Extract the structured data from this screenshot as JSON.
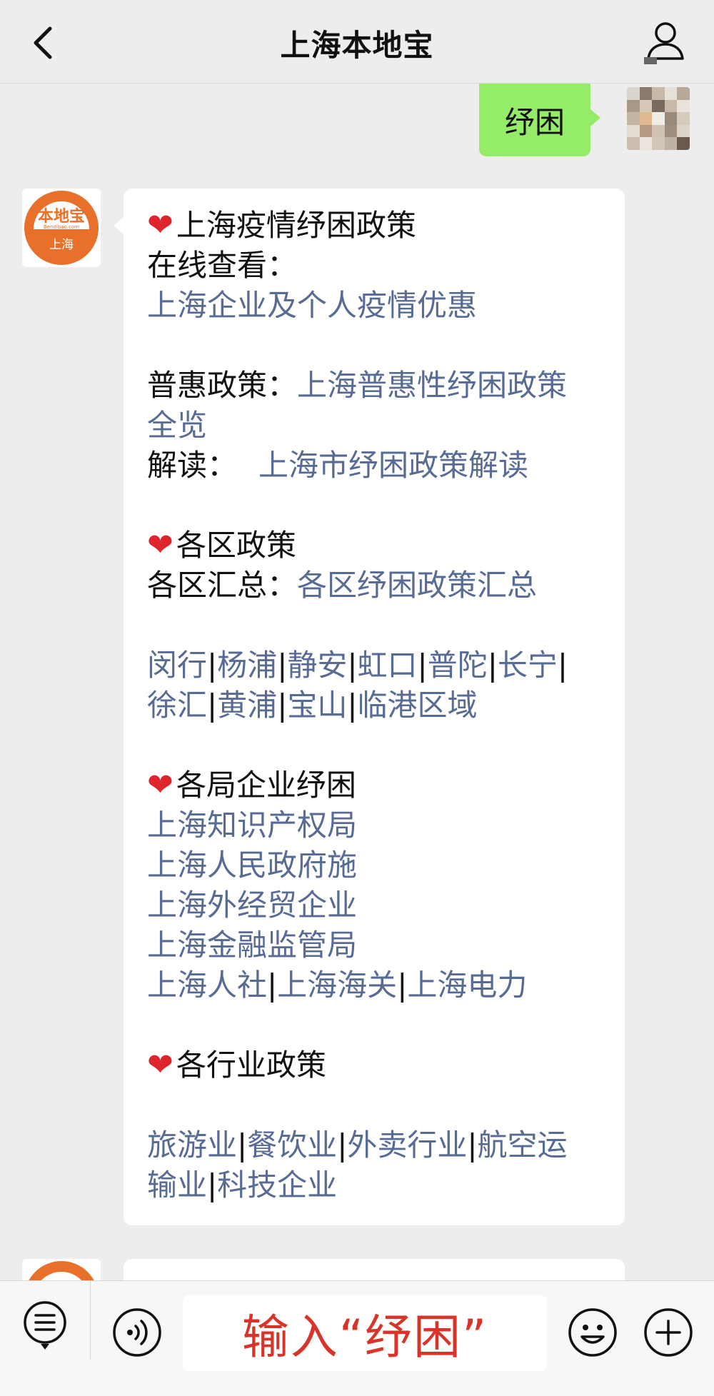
{
  "header": {
    "title": "上海本地宝"
  },
  "outgoing": {
    "text": "纾困"
  },
  "bot_avatar": {
    "logo_text": "本地宝",
    "logo_url_text": "Bendibao.com",
    "city_text": "上海"
  },
  "message": {
    "s1": {
      "heading": "上海疫情纾困政策",
      "line2": "在线查看：",
      "link1": "上海企业及个人疫情优惠"
    },
    "s2": {
      "label1": "普惠政策：",
      "link1a": "上海普惠性纾困政策",
      "link1b": "全览",
      "label2": "解读：",
      "link2": "上海市纾困政策解读"
    },
    "s3": {
      "heading": "各区政策",
      "label": "各区汇总：",
      "link": "各区纾困政策汇总",
      "districts_row1": [
        "闵行",
        "杨浦",
        "静安",
        "虹口",
        "普陀",
        "长宁"
      ],
      "districts_row2": [
        "徐汇",
        "黄浦",
        "宝山",
        "临港区域"
      ],
      "separator": "|"
    },
    "s4": {
      "heading": "各局企业纾困",
      "links": [
        "上海知识产权局",
        "上海人民政府施",
        "上海外经贸企业",
        "上海金融监管局"
      ],
      "row": [
        "上海人社",
        "上海海关",
        "上海电力"
      ]
    },
    "s5": {
      "heading": "各行业政策",
      "row1": [
        "旅游业",
        "餐饮业",
        "外卖行业",
        "航空运"
      ],
      "row2": [
        "输业",
        "科技企业"
      ]
    }
  },
  "input": {
    "text": "输入“纾困”"
  },
  "colors": {
    "link": "#576b95",
    "bubble_out": "#95ec69",
    "input_text": "#d8342a",
    "logo": "#e8702a",
    "heart": "#e0242b"
  },
  "icons": [
    "back-icon",
    "user-profile-icon",
    "menu-list-icon",
    "voice-icon",
    "emoji-icon",
    "add-icon",
    "heart-icon"
  ]
}
